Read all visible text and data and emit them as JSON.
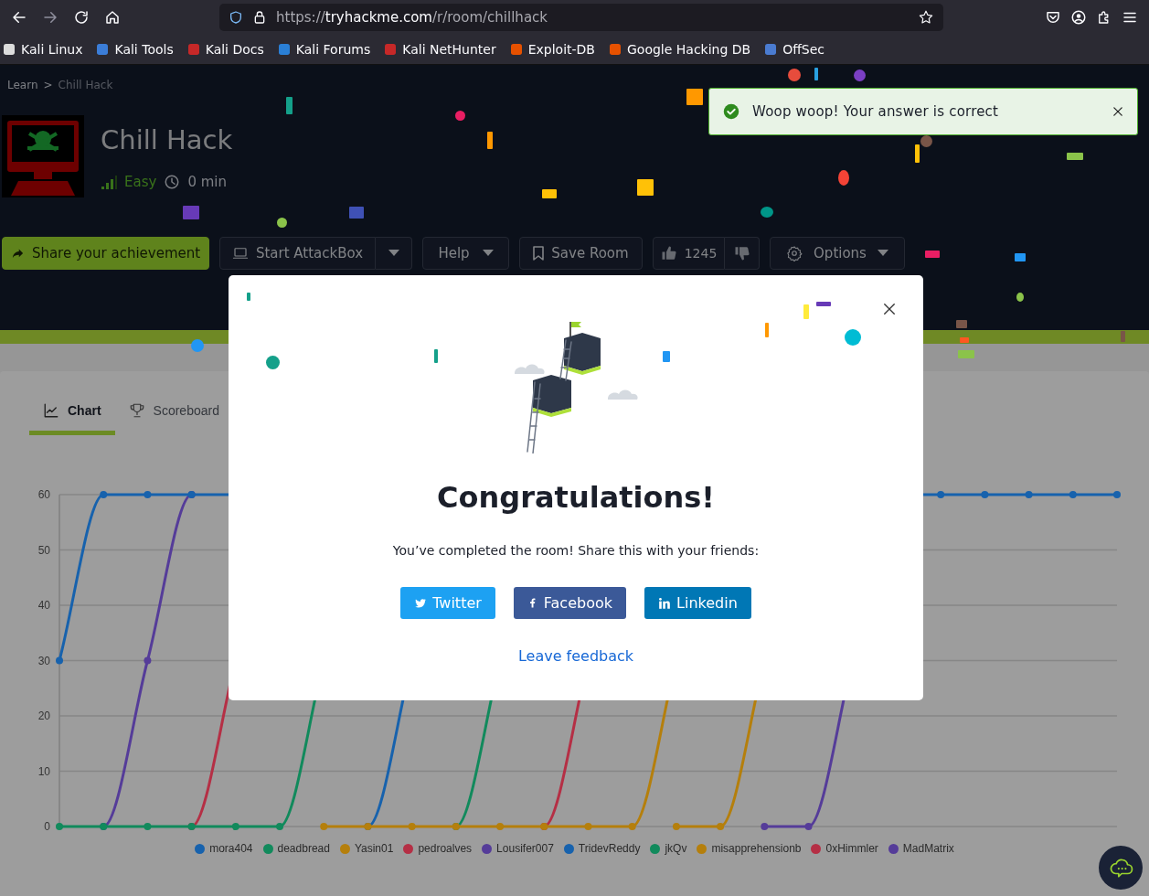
{
  "browser": {
    "url": {
      "scheme": "https://",
      "host": "tryhackme.com",
      "path": "/r/room/chillhack"
    },
    "bookmarks": [
      {
        "label": "Kali Linux"
      },
      {
        "label": "Kali Tools"
      },
      {
        "label": "Kali Docs"
      },
      {
        "label": "Kali Forums"
      },
      {
        "label": "Kali NetHunter"
      },
      {
        "label": "Exploit-DB"
      },
      {
        "label": "Google Hacking DB"
      },
      {
        "label": "OffSec"
      }
    ]
  },
  "breadcrumb": {
    "items": [
      "Learn",
      "Chill Hack"
    ],
    "separator": ">"
  },
  "room": {
    "title": "Chill Hack",
    "difficulty": "Easy",
    "duration": "0 min"
  },
  "actions": {
    "share": "Share your achievement",
    "attackbox": "Start AttackBox",
    "help": "Help",
    "save": "Save Room",
    "likes": "1245",
    "options": "Options"
  },
  "toast": {
    "message": "Woop woop! Your answer is correct"
  },
  "modal": {
    "title": "Congratulations!",
    "message": "You’ve completed the room! Share this with your friends:",
    "share_buttons": [
      {
        "label": "Twitter",
        "kind": "twitter"
      },
      {
        "label": "Facebook",
        "kind": "facebook"
      },
      {
        "label": "Linkedin",
        "kind": "linkedin"
      }
    ],
    "link": "Leave feedback"
  },
  "tabs": [
    {
      "label": "Chart",
      "selected": true
    },
    {
      "label": "Scoreboard",
      "selected": false
    }
  ],
  "chart": {
    "y_axis_labels": [
      "60",
      "50",
      "40",
      "30",
      "20",
      "10",
      "0"
    ],
    "legend": [
      {
        "name": "mora404",
        "color": "#1762ad"
      },
      {
        "name": "deadbread",
        "color": "#118a5c"
      },
      {
        "name": "Yasin01",
        "color": "#b57f0c"
      },
      {
        "name": "pedroalves",
        "color": "#b52f45"
      },
      {
        "name": "Lousifer007",
        "color": "#553c99"
      },
      {
        "name": "TridevReddy",
        "color": "#1762ad"
      },
      {
        "name": "jkQv",
        "color": "#118a5c"
      },
      {
        "name": "misapprehensionb",
        "color": "#b57f0c"
      },
      {
        "name": "0xHimmler",
        "color": "#b52f45"
      },
      {
        "name": "MadMatrix",
        "color": "#553c99"
      }
    ]
  }
}
